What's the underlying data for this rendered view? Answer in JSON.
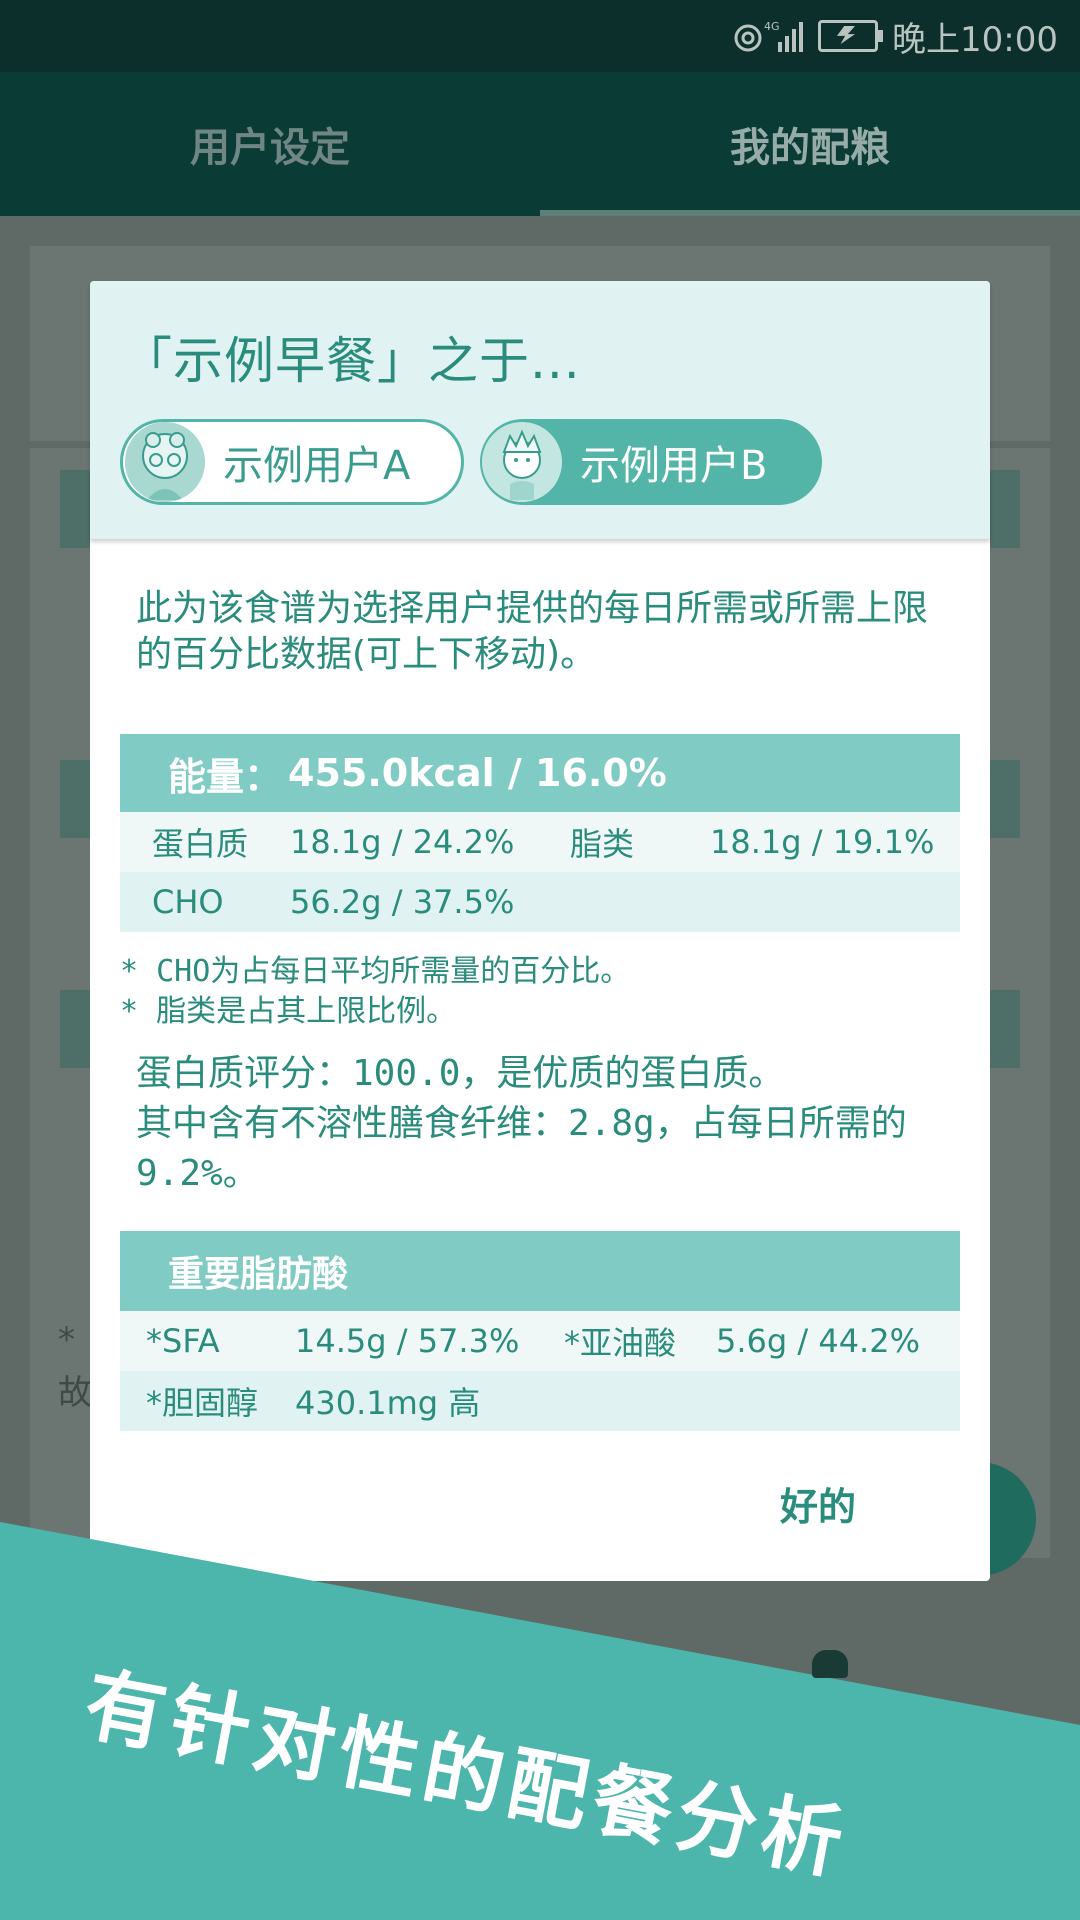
{
  "status_bar": {
    "time": "晚上10:00",
    "network": "4G",
    "sim": "1"
  },
  "app": {
    "tabs": [
      "用户设定",
      "我的配粮"
    ],
    "active_tab": 1
  },
  "background": {
    "note_fragment_1": "* ",
    "note_fragment_2": "故"
  },
  "dialog": {
    "title": "「示例早餐」之于...",
    "users": [
      {
        "label": "示例用户A",
        "selected": false,
        "avatar_icon": "grandma-avatar-icon"
      },
      {
        "label": "示例用户B",
        "selected": true,
        "avatar_icon": "boy-avatar-icon"
      }
    ],
    "intro": "此为该食谱为选择用户提供的每日所需或所需上限的百分比数据(可上下移动)。",
    "energy": {
      "label": "能量：",
      "value": "455.0kcal / 16.0%"
    },
    "nutrients": [
      {
        "name": "蛋白质",
        "value": "18.1g / 24.2%"
      },
      {
        "name": "脂类",
        "value": "18.1g / 19.1%"
      },
      {
        "name": "CHO",
        "value": "56.2g / 37.5%"
      }
    ],
    "notes": [
      "* CHO为占每日平均所需量的百分比。",
      "* 脂类是占其上限比例。"
    ],
    "protein_score": "蛋白质评分：100.0，是优质的蛋白质。",
    "fiber": "其中含有不溶性膳食纤维：2.8g，占每日所需的9.2%。",
    "fatty_acids": {
      "title": "重要脂肪酸",
      "items": [
        {
          "name": "*SFA",
          "value": "14.5g / 57.3%"
        },
        {
          "name": "*亚油酸",
          "value": "5.6g / 44.2%"
        },
        {
          "name": "*胆固醇",
          "value": "430.1mg 高"
        }
      ]
    },
    "ok_button": "好的"
  },
  "banner": {
    "text": "有针对性的配餐分析"
  },
  "colors": {
    "accent": "#2a8c7d",
    "chip": "#53b4a8",
    "table_header": "#80cbc4",
    "banner": "#4db6ac"
  }
}
